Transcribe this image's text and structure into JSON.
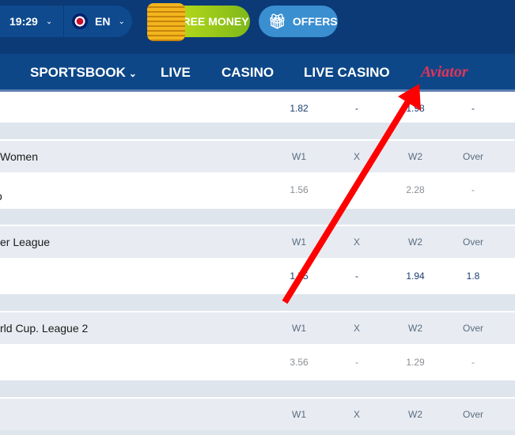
{
  "header": {
    "time": "19:29",
    "language": "EN",
    "free_money": "FREE MONEY",
    "offers": "OFFERS"
  },
  "nav": {
    "items": [
      "SPORTSBOOK",
      "LIVE",
      "CASINO",
      "LIVE CASINO",
      "Aviator"
    ]
  },
  "colors": {
    "header_bg": "#0b3a76",
    "nav_bg": "#0d4788",
    "aviator": "#e0345a",
    "arrow": "#ff0000"
  },
  "rows": [
    {
      "odds": [
        "1.82",
        "-",
        "1.98",
        "-"
      ]
    },
    {
      "league": "Women",
      "cols": [
        "W1",
        "X",
        "W2",
        "Over"
      ],
      "event_text": "o",
      "odds": [
        "1.56",
        "",
        "2.28",
        "-"
      ]
    },
    {
      "league": "er League",
      "cols": [
        "W1",
        "X",
        "W2",
        "Over"
      ],
      "odds": [
        "1.55",
        "-",
        "1.94",
        "1.8"
      ]
    },
    {
      "league": "rld Cup. League 2",
      "cols": [
        "W1",
        "X",
        "W2",
        "Over"
      ],
      "odds": [
        "3.56",
        "-",
        "1.29",
        "-"
      ]
    },
    {
      "cols": [
        "W1",
        "X",
        "W2",
        "Over"
      ]
    }
  ]
}
